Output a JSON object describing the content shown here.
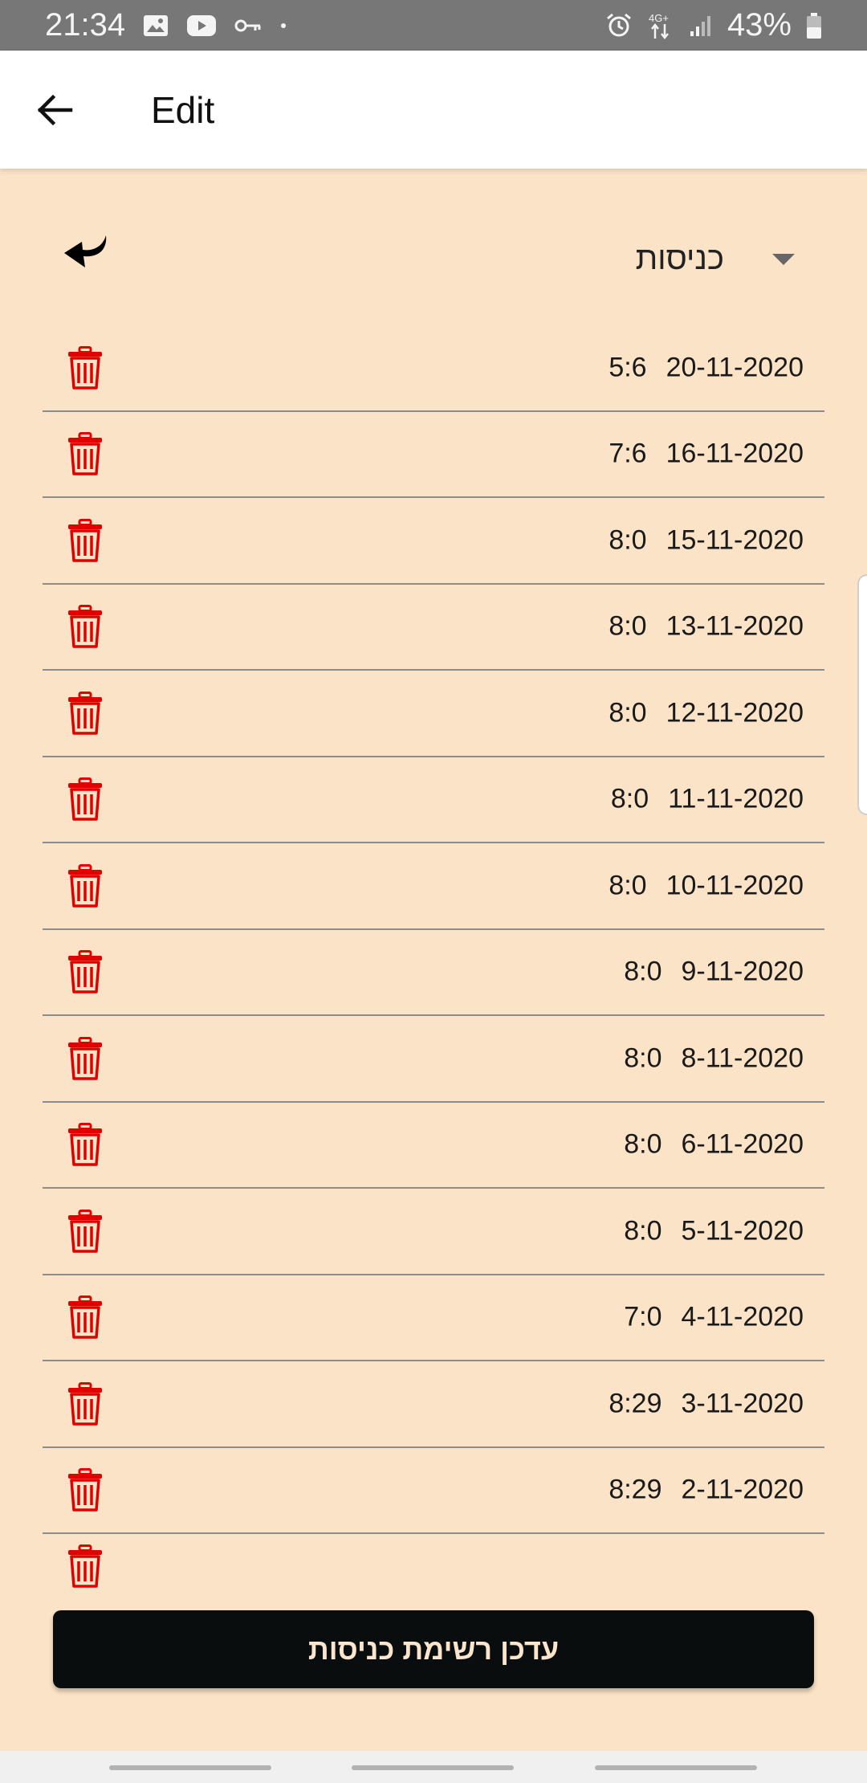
{
  "status_bar": {
    "time": "21:34",
    "network": "4G+",
    "battery": "43%",
    "icons": [
      "gallery-icon",
      "youtube-icon",
      "key-icon",
      "dot-icon",
      "alarm-icon",
      "network-arrows-icon",
      "signal-icon",
      "battery-icon"
    ]
  },
  "app_bar": {
    "title": "Edit"
  },
  "filter": {
    "selected": "כניסות"
  },
  "entries": [
    {
      "date": "20-11-2020",
      "time": "5:6"
    },
    {
      "date": "16-11-2020",
      "time": "7:6"
    },
    {
      "date": "15-11-2020",
      "time": "8:0"
    },
    {
      "date": "13-11-2020",
      "time": "8:0"
    },
    {
      "date": "12-11-2020",
      "time": "8:0"
    },
    {
      "date": "11-11-2020",
      "time": "8:0"
    },
    {
      "date": "10-11-2020",
      "time": "8:0"
    },
    {
      "date": "9-11-2020",
      "time": "8:0"
    },
    {
      "date": "8-11-2020",
      "time": "8:0"
    },
    {
      "date": "6-11-2020",
      "time": "8:0"
    },
    {
      "date": "5-11-2020",
      "time": "8:0"
    },
    {
      "date": "4-11-2020",
      "time": "7:0"
    },
    {
      "date": "3-11-2020",
      "time": "8:29"
    },
    {
      "date": "2-11-2020",
      "time": "8:29"
    }
  ],
  "update_button": {
    "label": "עדכן רשימת כניסות"
  },
  "colors": {
    "background": "#fbe3c7",
    "trash": "#e00000",
    "button_bg": "#0a0d0e",
    "button_text": "#fbe6cd",
    "status_bar": "#777777"
  }
}
